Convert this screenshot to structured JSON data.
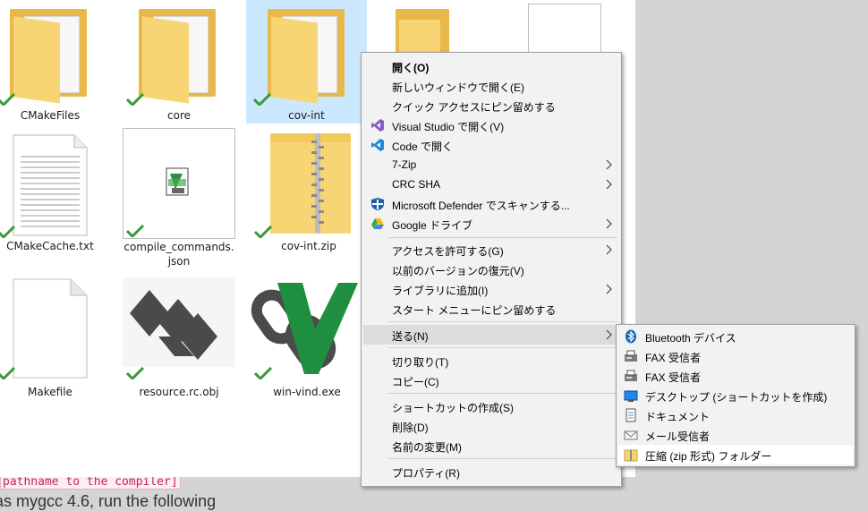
{
  "files": [
    {
      "name": "CMakeFiles"
    },
    {
      "name": "core"
    },
    {
      "name": "cov-int"
    },
    {
      "name": "CMakeCache.txt"
    },
    {
      "name": "compile_commands.json"
    },
    {
      "name": "cov-int.zip"
    },
    {
      "name": "Makefile"
    },
    {
      "name": "resource.rc.obj"
    },
    {
      "name": "win-vind.exe"
    }
  ],
  "background": {
    "code_snippet": "pathname to the compiler]",
    "prose": "as mygcc 4.6, run the following"
  },
  "context_menu": {
    "items": [
      {
        "label": "開く(O)"
      },
      {
        "label": "新しいウィンドウで開く(E)"
      },
      {
        "label": "クイック アクセスにピン留めする"
      },
      {
        "label": "Visual Studio で開く(V)",
        "icon": "visual-studio-icon"
      },
      {
        "label": "Code で開く",
        "icon": "vscode-icon"
      },
      {
        "label": "7-Zip"
      },
      {
        "label": "CRC SHA"
      },
      {
        "label": "Microsoft Defender でスキャンする...",
        "icon": "defender-icon"
      },
      {
        "label": "Google ドライブ",
        "icon": "google-drive-icon"
      },
      {
        "label": "アクセスを許可する(G)"
      },
      {
        "label": "以前のバージョンの復元(V)"
      },
      {
        "label": "ライブラリに追加(I)"
      },
      {
        "label": "スタート メニューにピン留めする"
      },
      {
        "label": "送る(N)"
      },
      {
        "label": "切り取り(T)"
      },
      {
        "label": "コピー(C)"
      },
      {
        "label": "ショートカットの作成(S)"
      },
      {
        "label": "削除(D)"
      },
      {
        "label": "名前の変更(M)"
      },
      {
        "label": "プロパティ(R)"
      }
    ]
  },
  "send_to_menu": {
    "items": [
      {
        "label": "Bluetooth デバイス",
        "icon": "bluetooth-icon"
      },
      {
        "label": "FAX 受信者",
        "icon": "fax-icon"
      },
      {
        "label": "FAX 受信者",
        "icon": "fax-icon"
      },
      {
        "label": "デスクトップ (ショートカットを作成)",
        "icon": "desktop-icon"
      },
      {
        "label": "ドキュメント",
        "icon": "documents-icon"
      },
      {
        "label": "メール受信者",
        "icon": "mail-icon"
      },
      {
        "label": "圧縮 (zip 形式) フォルダー",
        "icon": "zip-folder-icon"
      }
    ]
  },
  "colors": {
    "selection": "#cce8ff",
    "menu_background": "#f2f2f2",
    "menu_highlight": "#dcdcdc",
    "check_green": "#3a9a3a",
    "folder": "#f8d574"
  }
}
